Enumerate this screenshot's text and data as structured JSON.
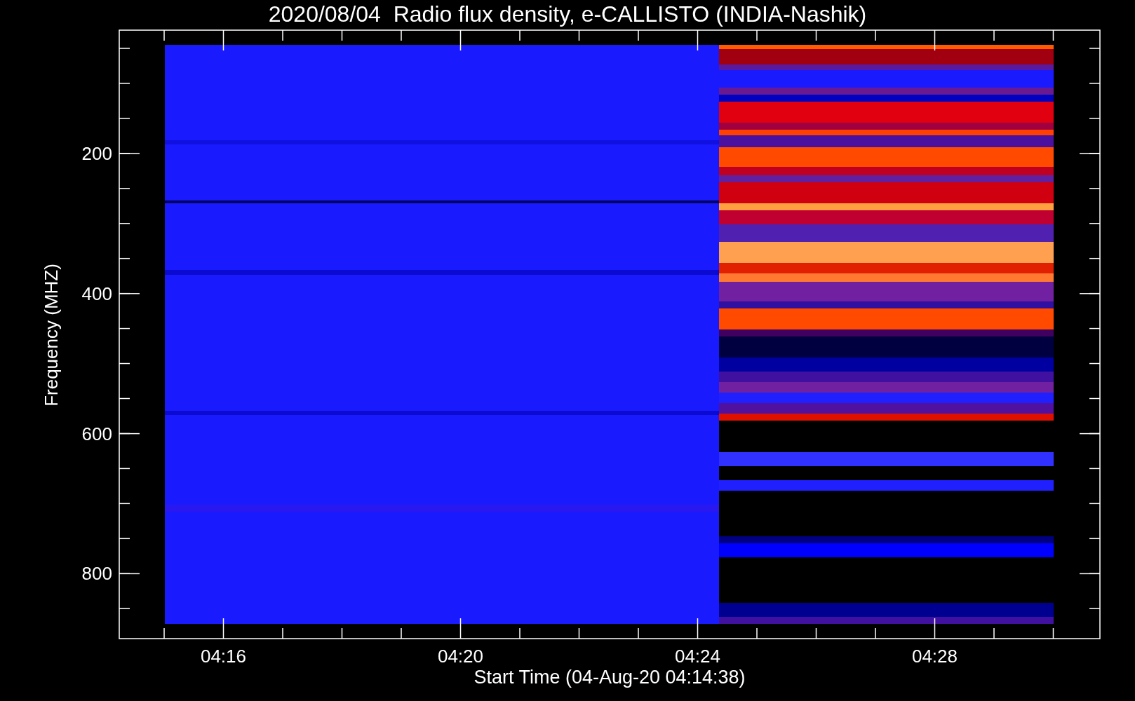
{
  "title": "2020/08/04  Radio flux density, e-CALLISTO (INDIA-Nashik)",
  "y_axis": {
    "label": "Frequency (MHZ)",
    "ticks": [
      "200",
      "400",
      "600",
      "800"
    ]
  },
  "x_axis": {
    "label": "Start Time (04-Aug-20 04:14:38)",
    "ticks": [
      "04:16",
      "04:20",
      "04:24",
      "04:28"
    ]
  }
}
